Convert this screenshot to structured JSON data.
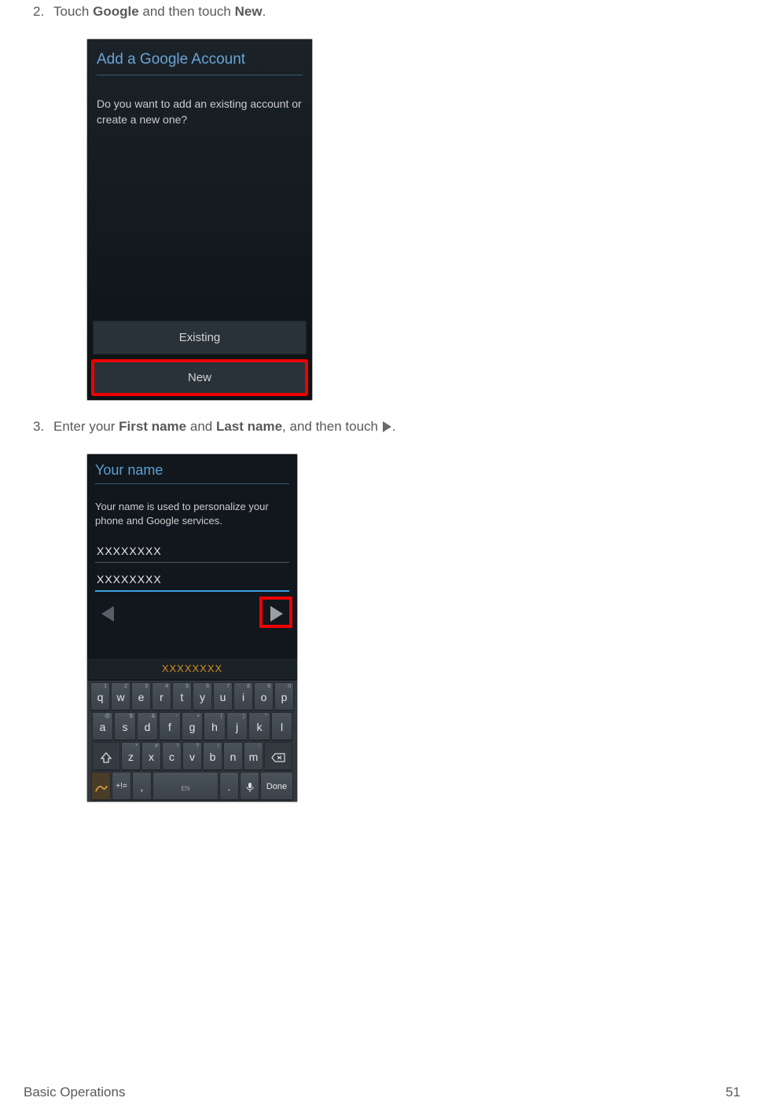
{
  "step2": {
    "num": "2.",
    "text_prefix": "Touch ",
    "bold1": "Google",
    "text_mid": " and then touch ",
    "bold2": "New",
    "text_suffix": "."
  },
  "step3": {
    "num": "3.",
    "text_prefix": "Enter your ",
    "bold1": "First name",
    "text_mid": " and ",
    "bold2": "Last name",
    "text_after_bold2": ", and then touch ",
    "text_suffix": "."
  },
  "shot1": {
    "title": "Add a Google Account",
    "body": "Do you want to add an existing account or create a new one?",
    "btn_existing": "Existing",
    "btn_new": "New"
  },
  "shot2": {
    "title": "Your name",
    "desc": "Your name is used to personalize your phone and Google services.",
    "input_first": "XXXXXXXX",
    "input_last": "XXXXXXXX",
    "suggestion": "XXXXXXXX"
  },
  "keyboard": {
    "row1": [
      "q",
      "w",
      "e",
      "r",
      "t",
      "y",
      "u",
      "i",
      "o",
      "p"
    ],
    "row1_sup": [
      "1",
      "2",
      "3",
      "4",
      "5",
      "6",
      "7",
      "8",
      "9",
      "0"
    ],
    "row2": [
      "a",
      "s",
      "d",
      "f",
      "g",
      "h",
      "j",
      "k",
      "l"
    ],
    "row2_sup": [
      "@",
      "$",
      "&",
      "-",
      "+",
      "(",
      ")",
      "\"",
      ""
    ],
    "row3": [
      "z",
      "x",
      "c",
      "v",
      "b",
      "n",
      "m"
    ],
    "row3_sup": [
      "*",
      "#",
      "!",
      "?",
      "/",
      "",
      ":"
    ],
    "sym": "+!=",
    "comma": ",",
    "space_label": "EN",
    "period": ".",
    "done": "Done"
  },
  "footer": {
    "section": "Basic Operations",
    "page": "51"
  }
}
